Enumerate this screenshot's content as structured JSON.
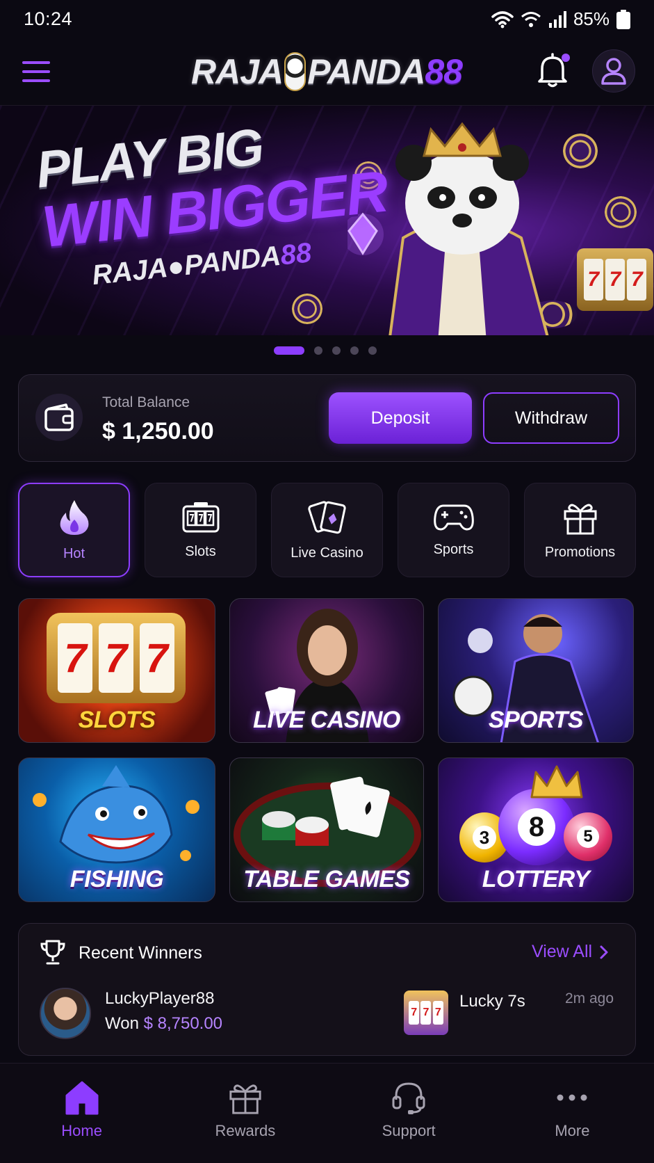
{
  "status_bar": {
    "time": "10:24",
    "battery": "85%"
  },
  "header": {
    "brand_part1": "RAJA",
    "brand_part2": "PANDA",
    "brand_part3": "88"
  },
  "banner": {
    "line1": "PLAY BIG",
    "line2": "WIN BIGGER",
    "brand_part1": "RAJA",
    "brand_part2": "PANDA",
    "brand_part3": "88",
    "slot_reels": [
      "7",
      "7",
      "7"
    ],
    "pages": 5,
    "active_page": 1
  },
  "balance": {
    "label": "Total Balance",
    "value": "$ 1,250.00",
    "deposit_label": "Deposit",
    "withdraw_label": "Withdraw"
  },
  "categories": [
    {
      "label": "Hot",
      "icon": "flame-icon",
      "active": true
    },
    {
      "label": "Slots",
      "icon": "slot-machine-icon",
      "active": false
    },
    {
      "label": "Live Casino",
      "icon": "cards-icon",
      "active": false
    },
    {
      "label": "Sports",
      "icon": "gamepad-icon",
      "active": false
    },
    {
      "label": "Promotions",
      "icon": "gift-icon",
      "active": false
    }
  ],
  "games": [
    {
      "label": "SLOTS"
    },
    {
      "label": "LIVE CASINO"
    },
    {
      "label": "SPORTS"
    },
    {
      "label": "FISHING"
    },
    {
      "label": "TABLE GAMES"
    },
    {
      "label": "LOTTERY"
    }
  ],
  "winners": {
    "title": "Recent Winners",
    "view_all": "View All",
    "entry": {
      "name": "LuckyPlayer88",
      "won_prefix": "Won",
      "amount": "$ 8,750.00",
      "game": "Lucky 7s",
      "time": "2m ago"
    }
  },
  "bottom_nav": [
    {
      "label": "Home",
      "icon": "home-icon",
      "active": true
    },
    {
      "label": "Rewards",
      "icon": "gift-icon",
      "active": false
    },
    {
      "label": "Support",
      "icon": "headset-icon",
      "active": false
    },
    {
      "label": "More",
      "icon": "more-dots-icon",
      "active": false
    }
  ],
  "colors": {
    "accent": "#8d3dff",
    "background": "#0b0912",
    "card": "#16121e"
  }
}
